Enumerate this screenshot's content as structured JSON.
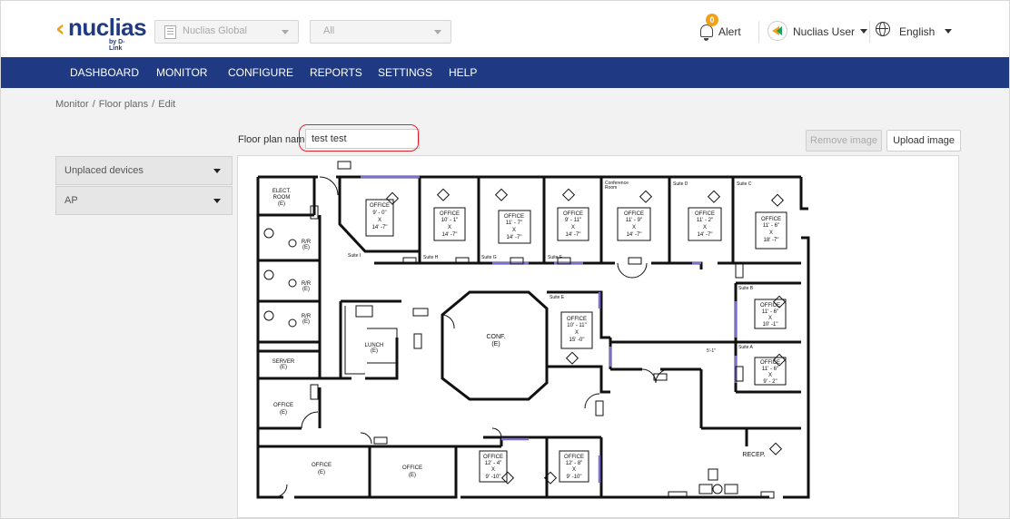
{
  "header": {
    "logo_text": "nuclias",
    "logo_sub": "by D-Link",
    "site_selector": {
      "value": "Nuclias Global"
    },
    "filter_selector": {
      "value": "All"
    },
    "alert": {
      "count": "0",
      "label": "Alert"
    },
    "user": {
      "label": "Nuclias User"
    },
    "language": {
      "label": "English"
    }
  },
  "nav": {
    "items": [
      {
        "label": "DASHBOARD"
      },
      {
        "label": "MONITOR"
      },
      {
        "label": "CONFIGURE"
      },
      {
        "label": "REPORTS"
      },
      {
        "label": "SETTINGS"
      },
      {
        "label": "HELP"
      }
    ]
  },
  "breadcrumb": {
    "items": [
      "Monitor",
      "Floor plans",
      "Edit"
    ],
    "separator": "/"
  },
  "form": {
    "floor_plan_name_label": "Floor plan name",
    "floor_plan_name_value": "test test",
    "remove_image_label": "Remove image",
    "upload_image_label": "Upload image"
  },
  "left_panel": {
    "unplaced_devices_label": "Unplaced devices",
    "ap_label": "AP"
  },
  "floorplan": {
    "rooms": {
      "elect_room": [
        "ELECT.",
        "ROOM",
        "(E)"
      ],
      "restroom": [
        "R/R",
        "(E)"
      ],
      "server": [
        "SERVER",
        "(E)"
      ],
      "office_1": [
        "OFFICE",
        "9' - 0\"",
        "X",
        "14' -7\""
      ],
      "office_2": [
        "OFFICE",
        "10' - 1\"",
        "X",
        "14' -7\""
      ],
      "office_3": [
        "OFFICE",
        "11' - 7\"",
        "X",
        "14' -7\""
      ],
      "office_4": [
        "OFFICE",
        "9' - 11\"",
        "X",
        "14' -7\""
      ],
      "office_5": [
        "OFFICE",
        "11' - 9\"",
        "X",
        "14' -7\""
      ],
      "office_6": [
        "OFFICE",
        "11' - 2\"",
        "X",
        "14' -7\""
      ],
      "office_7": [
        "OFFICE",
        "11' - 6\"",
        "X",
        "18' -7\""
      ],
      "office_e": [
        "OFFICE",
        "10' - 11\"",
        "X",
        "15' -0\""
      ],
      "office_b": [
        "OFFICE",
        "11' - 6\"",
        "X",
        "10' -1\""
      ],
      "office_a": [
        "OFFICE",
        "11' - 6\"",
        "X",
        "9' - 2\""
      ],
      "office_bot1": [
        "OFFICE",
        "12' - 4\"",
        "X",
        "9' -10\""
      ],
      "office_bot2": [
        "OFFICE",
        "12' - 8\"",
        "X",
        "9' -10\""
      ],
      "lunch": [
        "LUNCH",
        "(E)"
      ],
      "conf": [
        "CONF.",
        "(E)"
      ],
      "office_left": [
        "OFFICE",
        "(E)"
      ],
      "recep": "RECEP."
    },
    "suites": {
      "suite_i": "Suite I",
      "suite_h": "Suite H",
      "suite_g": "Suite G",
      "suite_f": "Suite F",
      "suite_e": "Suite E",
      "suite_d": "Suite D",
      "suite_c": "Suite C",
      "suite_b": "Suite B",
      "suite_a": "Suite A",
      "conference_room": [
        "Conference",
        "Room"
      ]
    },
    "dim_label": "5'-1\""
  }
}
